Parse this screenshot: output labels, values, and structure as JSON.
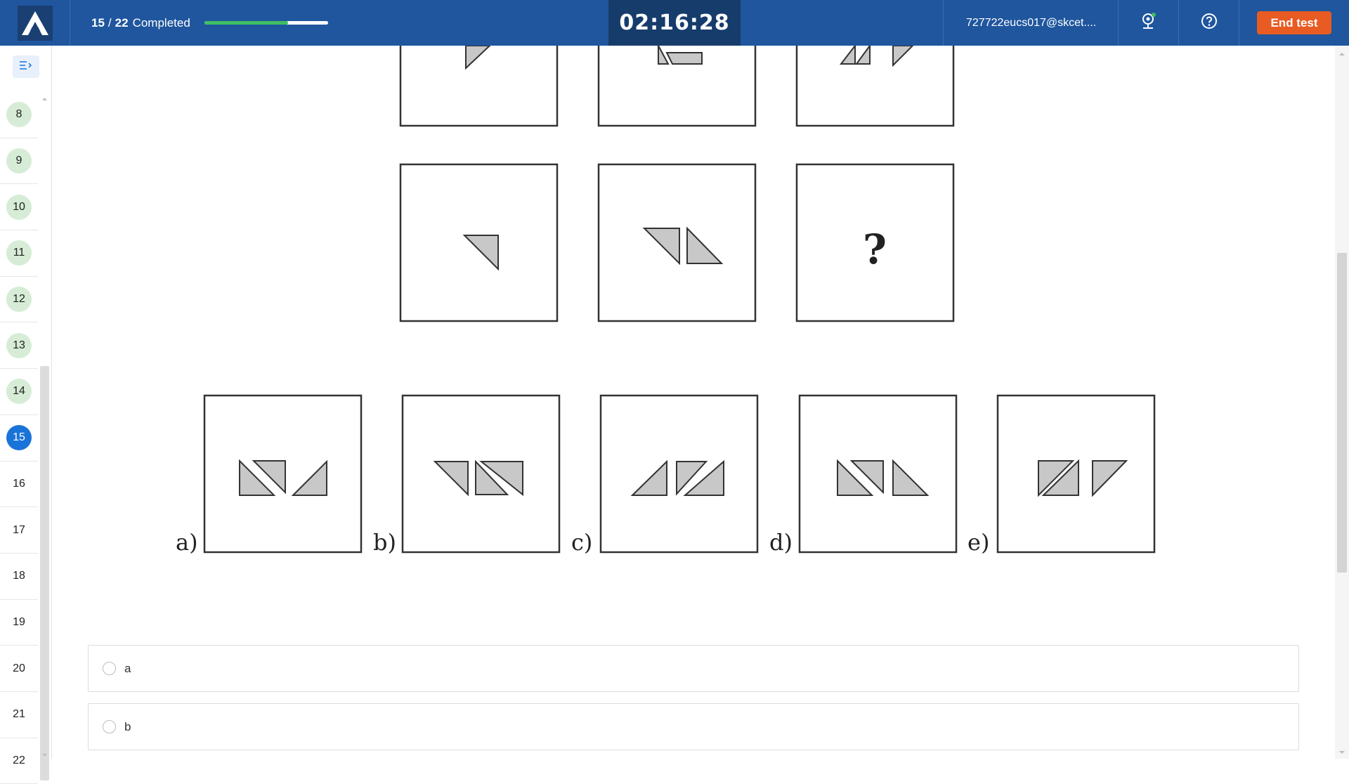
{
  "header": {
    "progress_current": "15",
    "progress_sep": "/",
    "progress_total": "22",
    "progress_label": "Completed",
    "progress_fraction": 0.68,
    "timer": "02:16:28",
    "user_email": "727722eucs017@skcet....",
    "end_test_label": "End test",
    "icons": [
      "logo-a-icon",
      "webcam-icon",
      "help-icon"
    ]
  },
  "sidebar": {
    "toggle_icon": "collapse-sidebar-icon",
    "questions": [
      {
        "num": "8",
        "state": "done"
      },
      {
        "num": "9",
        "state": "done"
      },
      {
        "num": "10",
        "state": "done"
      },
      {
        "num": "11",
        "state": "done"
      },
      {
        "num": "12",
        "state": "done"
      },
      {
        "num": "13",
        "state": "done"
      },
      {
        "num": "14",
        "state": "done"
      },
      {
        "num": "15",
        "state": "current"
      },
      {
        "num": "16",
        "state": "todo"
      },
      {
        "num": "17",
        "state": "todo"
      },
      {
        "num": "18",
        "state": "todo"
      },
      {
        "num": "19",
        "state": "todo"
      },
      {
        "num": "20",
        "state": "todo"
      },
      {
        "num": "21",
        "state": "todo"
      },
      {
        "num": "22",
        "state": "todo"
      }
    ]
  },
  "question": {
    "missing_mark": "?",
    "option_letters": [
      "a)",
      "b)",
      "c)",
      "d)",
      "e)"
    ]
  },
  "answers": [
    {
      "label": "a"
    },
    {
      "label": "b"
    }
  ],
  "colors": {
    "header_bg": "#1f569e",
    "timer_bg": "#163c6c",
    "end_button": "#e85b22",
    "current_question": "#1a73d9",
    "answered_question": "#d6ecd6",
    "progress_fill": "#3fbf62"
  }
}
